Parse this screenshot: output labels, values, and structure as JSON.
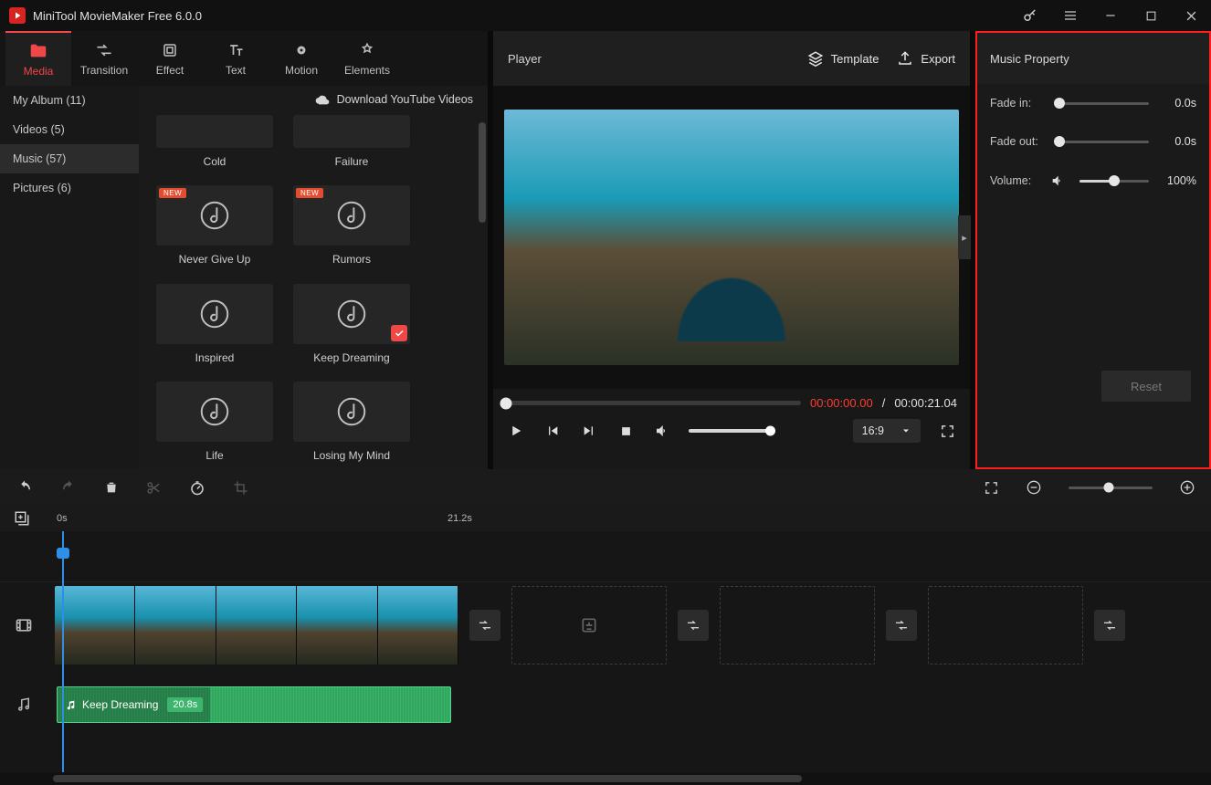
{
  "titlebar": {
    "title": "MiniTool MovieMaker Free 6.0.0"
  },
  "tabs": [
    {
      "label": "Media"
    },
    {
      "label": "Transition"
    },
    {
      "label": "Effect"
    },
    {
      "label": "Text"
    },
    {
      "label": "Motion"
    },
    {
      "label": "Elements"
    }
  ],
  "albums": [
    {
      "label": "My Album (11)"
    },
    {
      "label": "Videos (5)"
    },
    {
      "label": "Music (57)"
    },
    {
      "label": "Pictures (6)"
    }
  ],
  "download_link": "Download YouTube Videos",
  "music_items": [
    {
      "label": "Cold",
      "new": false,
      "checked": false,
      "first": true
    },
    {
      "label": "Failure",
      "new": false,
      "checked": false,
      "first": true
    },
    {
      "label": "Never Give Up",
      "new": true,
      "checked": false
    },
    {
      "label": "Rumors",
      "new": true,
      "checked": false
    },
    {
      "label": "Inspired",
      "new": false,
      "checked": false
    },
    {
      "label": "Keep Dreaming",
      "new": false,
      "checked": true
    },
    {
      "label": "Life",
      "new": false,
      "checked": false
    },
    {
      "label": "Losing My Mind",
      "new": false,
      "checked": false
    }
  ],
  "player": {
    "title": "Player",
    "template": "Template",
    "export": "Export",
    "time_current": "00:00:00.00",
    "time_sep": " / ",
    "time_total": "00:00:21.04",
    "aspect": "16:9"
  },
  "props": {
    "title": "Music Property",
    "fadein_label": "Fade in:",
    "fadein_val": "0.0s",
    "fadeout_label": "Fade out:",
    "fadeout_val": "0.0s",
    "volume_label": "Volume:",
    "volume_val": "100%",
    "reset": "Reset"
  },
  "ruler": {
    "t0": "0s",
    "t1": "21.2s"
  },
  "audio_clip": {
    "name": "Keep Dreaming",
    "dur": "20.8s"
  }
}
